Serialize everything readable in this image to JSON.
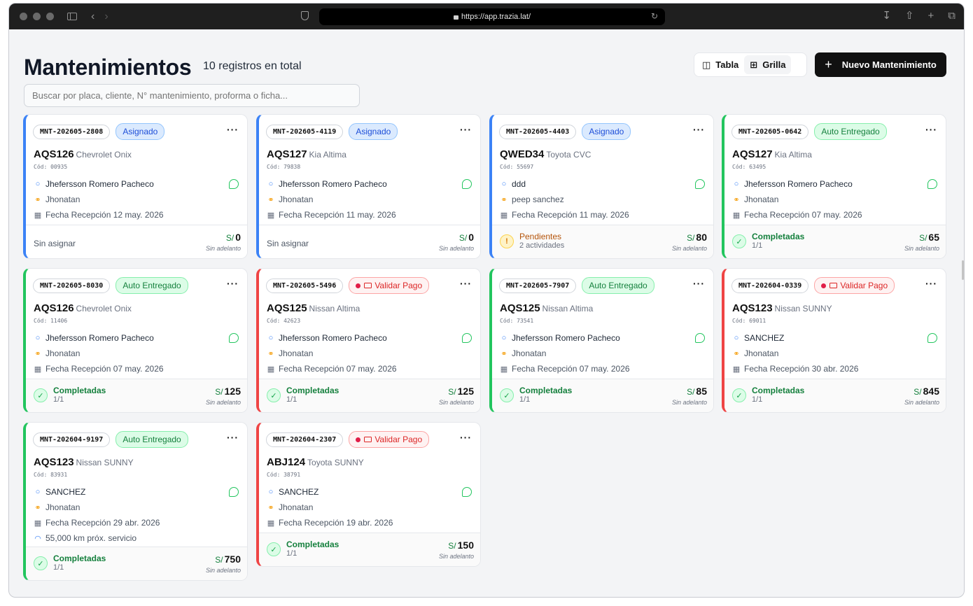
{
  "browser": {
    "url": "https://app.trazia.lat/"
  },
  "page": {
    "title": "Mantenimientos",
    "subtitle": "10 registros en total",
    "search_placeholder": "Buscar por placa, cliente, N° mantenimiento, proforma o ficha...",
    "view_toggle": {
      "table_label": "Tabla",
      "grid_label": "Grilla",
      "active": "Grilla"
    },
    "new_button_label": "Nuevo Mantenimiento"
  },
  "colors": {
    "asignado": "#3b82f6",
    "auto_entregado": "#22c55e",
    "validar_pago": "#ef4444"
  },
  "cards": [
    {
      "id": "MNT-202605-2808",
      "status": "Asignado",
      "status_type": "asignado",
      "plate": "AQS126",
      "model": "Chevrolet Onix",
      "cod": "Cód: 00935",
      "client": "Jhefersson Romero Pacheco",
      "tech": "Jhonatan",
      "date": "Fecha Recepción 12 may. 2026",
      "km": "",
      "footer_label": "Sin asignar",
      "footer_sub": "",
      "footer_type": "none",
      "currency": "S/",
      "amount": "0",
      "advance": "Sin adelanto"
    },
    {
      "id": "MNT-202605-4119",
      "status": "Asignado",
      "status_type": "asignado",
      "plate": "AQS127",
      "model": "Kia Altima",
      "cod": "Cód: 79838",
      "client": "Jhefersson Romero Pacheco",
      "tech": "Jhonatan",
      "date": "Fecha Recepción 11 may. 2026",
      "km": "",
      "footer_label": "Sin asignar",
      "footer_sub": "",
      "footer_type": "none",
      "currency": "S/",
      "amount": "0",
      "advance": "Sin adelanto"
    },
    {
      "id": "MNT-202605-4403",
      "status": "Asignado",
      "status_type": "asignado",
      "plate": "QWED34",
      "model": "Toyota CVC",
      "cod": "Cód: 55697",
      "client": "ddd",
      "tech": "peep sanchez",
      "date": "Fecha Recepción 11 may. 2026",
      "km": "",
      "footer_label": "Pendientes",
      "footer_sub": "2 actividades",
      "footer_type": "pend",
      "currency": "S/",
      "amount": "80",
      "advance": "Sin adelanto"
    },
    {
      "id": "MNT-202605-0642",
      "status": "Auto Entregado",
      "status_type": "auto",
      "plate": "AQS127",
      "model": "Kia Altima",
      "cod": "Cód: 63495",
      "client": "Jhefersson Romero Pacheco",
      "tech": "Jhonatan",
      "date": "Fecha Recepción 07 may. 2026",
      "km": "",
      "footer_label": "Completadas",
      "footer_sub": "1/1",
      "footer_type": "ok",
      "currency": "S/",
      "amount": "65",
      "advance": "Sin adelanto"
    },
    {
      "id": "MNT-202605-8030",
      "status": "Auto Entregado",
      "status_type": "auto",
      "plate": "AQS126",
      "model": "Chevrolet Onix",
      "cod": "Cód: 11406",
      "client": "Jhefersson Romero Pacheco",
      "tech": "Jhonatan",
      "date": "Fecha Recepción 07 may. 2026",
      "km": "",
      "footer_label": "Completadas",
      "footer_sub": "1/1",
      "footer_type": "ok",
      "currency": "S/",
      "amount": "125",
      "advance": "Sin adelanto"
    },
    {
      "id": "MNT-202605-5496",
      "status": "Validar Pago",
      "status_type": "validar",
      "plate": "AQS125",
      "model": "Nissan Altima",
      "cod": "Cód: 42623",
      "client": "Jhefersson Romero Pacheco",
      "tech": "Jhonatan",
      "date": "Fecha Recepción 07 may. 2026",
      "km": "",
      "footer_label": "Completadas",
      "footer_sub": "1/1",
      "footer_type": "ok",
      "currency": "S/",
      "amount": "125",
      "advance": "Sin adelanto"
    },
    {
      "id": "MNT-202605-7907",
      "status": "Auto Entregado",
      "status_type": "auto",
      "plate": "AQS125",
      "model": "Nissan Altima",
      "cod": "Cód: 73541",
      "client": "Jhefersson Romero Pacheco",
      "tech": "Jhonatan",
      "date": "Fecha Recepción 07 may. 2026",
      "km": "",
      "footer_label": "Completadas",
      "footer_sub": "1/1",
      "footer_type": "ok",
      "currency": "S/",
      "amount": "85",
      "advance": "Sin adelanto"
    },
    {
      "id": "MNT-202604-0339",
      "status": "Validar Pago",
      "status_type": "validar",
      "plate": "AQS123",
      "model": "Nissan SUNNY",
      "cod": "Cód: 69011",
      "client": "SANCHEZ",
      "tech": "Jhonatan",
      "date": "Fecha Recepción 30 abr. 2026",
      "km": "",
      "footer_label": "Completadas",
      "footer_sub": "1/1",
      "footer_type": "ok",
      "currency": "S/",
      "amount": "845",
      "advance": "Sin adelanto"
    },
    {
      "id": "MNT-202604-9197",
      "status": "Auto Entregado",
      "status_type": "auto",
      "plate": "AQS123",
      "model": "Nissan SUNNY",
      "cod": "Cód: 83931",
      "client": "SANCHEZ",
      "tech": "Jhonatan",
      "date": "Fecha Recepción 29 abr. 2026",
      "km": "55,000 km próx. servicio",
      "footer_label": "Completadas",
      "footer_sub": "1/1",
      "footer_type": "ok",
      "currency": "S/",
      "amount": "750",
      "advance": "Sin adelanto"
    },
    {
      "id": "MNT-202604-2307",
      "status": "Validar Pago",
      "status_type": "validar",
      "plate": "ABJ124",
      "model": "Toyota SUNNY",
      "cod": "Cód: 38791",
      "client": "SANCHEZ",
      "tech": "Jhonatan",
      "date": "Fecha Recepción 19 abr. 2026",
      "km": "",
      "footer_label": "Completadas",
      "footer_sub": "1/1",
      "footer_type": "ok",
      "currency": "S/",
      "amount": "150",
      "advance": "Sin adelanto"
    }
  ]
}
